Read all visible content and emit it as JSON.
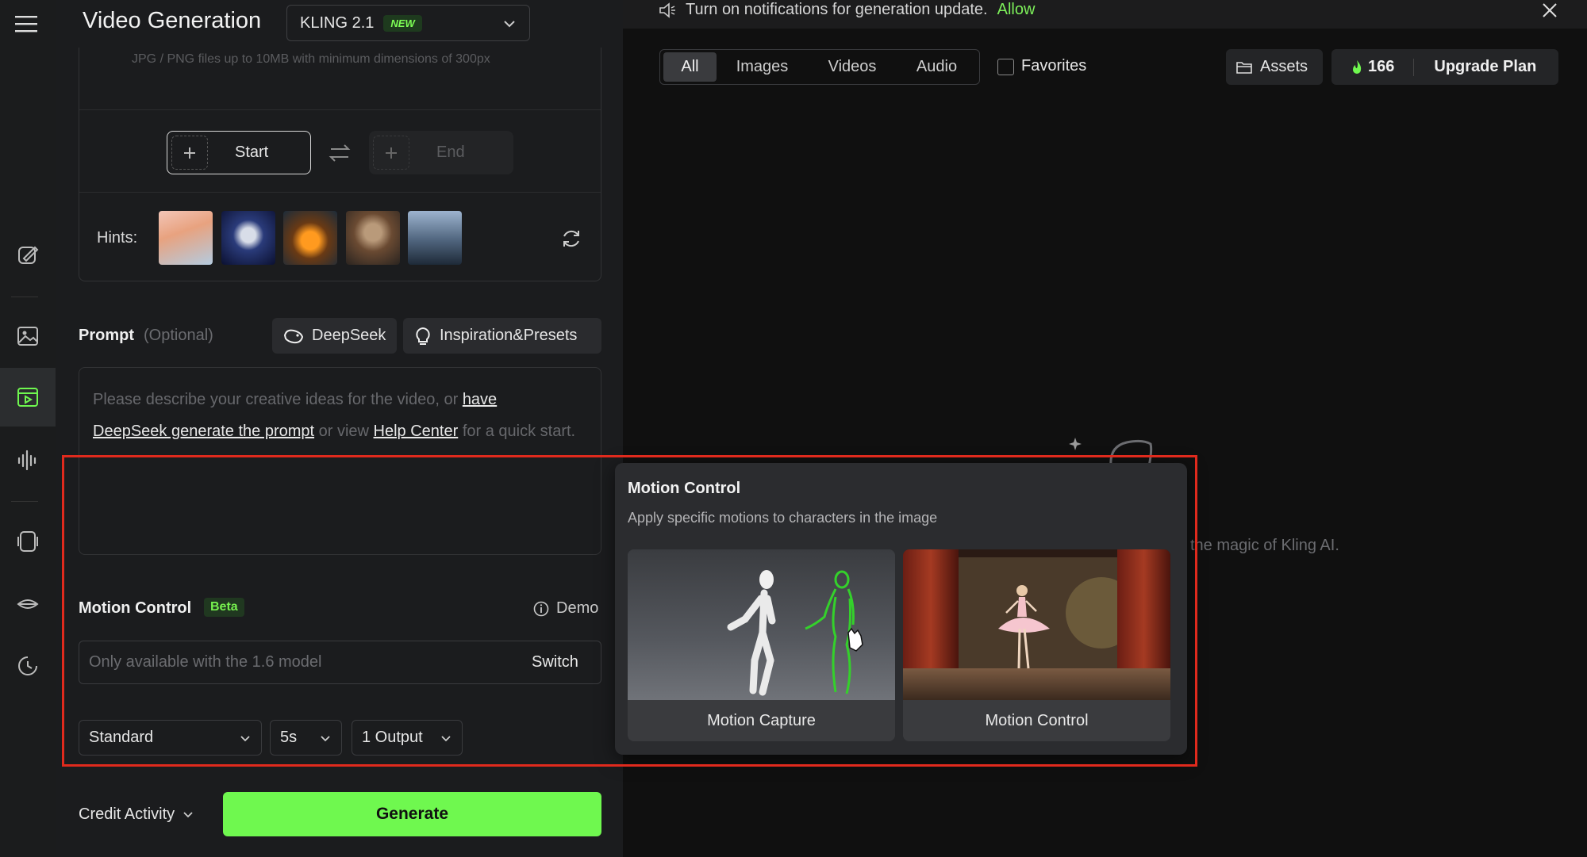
{
  "header": {
    "title": "Video Generation",
    "model": "KLING 2.1",
    "model_badge": "NEW"
  },
  "upload": {
    "note": "JPG / PNG files up to 10MB with minimum dimensions of 300px",
    "start_label": "Start",
    "end_label": "End",
    "hints_label": "Hints:"
  },
  "prompt": {
    "label": "Prompt",
    "optional": "(Optional)",
    "deepseek_chip": "DeepSeek",
    "inspiration_chip": "Inspiration&Presets",
    "placeholder_pre": "Please describe your creative ideas for the video, or ",
    "link_have": "have",
    "link_deepseek": "DeepSeek generate the prompt",
    "mid": " or view ",
    "link_help": "Help Center",
    "post": " for a quick start."
  },
  "motion_control": {
    "label": "Motion Control",
    "badge": "Beta",
    "demo": "Demo",
    "placeholder": "Only available with the 1.6 model",
    "switch": "Switch"
  },
  "options": {
    "mode": "Standard",
    "duration": "5s",
    "outputs": "1 Output"
  },
  "footer": {
    "credit_activity": "Credit Activity",
    "generate": "Generate"
  },
  "notification": {
    "text": "Turn on notifications for generation update.",
    "allow": "Allow"
  },
  "filters": {
    "tabs": [
      "All",
      "Images",
      "Videos",
      "Audio"
    ],
    "active": "All",
    "favorites": "Favorites"
  },
  "top_right": {
    "assets": "Assets",
    "credits": "166",
    "upgrade": "Upgrade Plan"
  },
  "empty_state": {
    "text": "the magic of Kling AI."
  },
  "popup": {
    "title": "Motion Control",
    "description": "Apply specific motions to characters in the image",
    "cards": [
      {
        "label": "Motion Capture"
      },
      {
        "label": "Motion Control"
      }
    ]
  },
  "colors": {
    "accent": "#6ff84f",
    "highlight_box": "#e02a1d"
  }
}
